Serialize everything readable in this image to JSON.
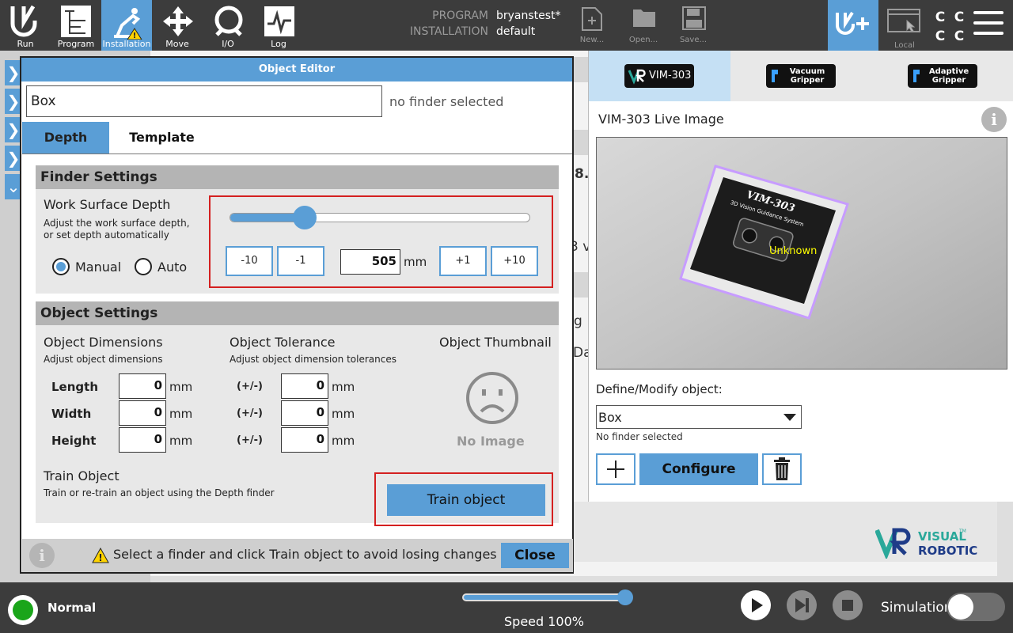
{
  "nav": [
    {
      "label": "Run",
      "icon": "ur-logo-icon"
    },
    {
      "label": "Program",
      "icon": "program-icon"
    },
    {
      "label": "Installation",
      "icon": "installation-icon"
    },
    {
      "label": "Move",
      "icon": "move-icon"
    },
    {
      "label": "I/O",
      "icon": "io-icon"
    },
    {
      "label": "Log",
      "icon": "log-icon"
    }
  ],
  "header": {
    "program_key": "PROGRAM",
    "program_value": "bryanstest*",
    "installation_key": "INSTALLATION",
    "installation_value": "default",
    "new_label": "New...",
    "open_label": "Open...",
    "save_label": "Save...",
    "local_label": "Local",
    "cc": [
      "C",
      "C",
      "C",
      "C"
    ]
  },
  "background": {
    "frag_number": "8.",
    "frag_v": "3 v",
    "frag_g": "g",
    "frag_da": "Da"
  },
  "editor": {
    "title": "Object Editor",
    "object_name": "Box",
    "finder_status": "no finder selected",
    "tabs": [
      "Depth",
      "Template"
    ],
    "finder_settings": {
      "heading": "Finder Settings",
      "work_surface_label": "Work Surface Depth",
      "work_surface_hint": "Adjust the work surface depth, or set depth automatically",
      "mode_manual": "Manual",
      "mode_auto": "Auto",
      "selected_mode": "Manual",
      "slider_fraction": 0.25,
      "steps": [
        "-10",
        "-1",
        "+1",
        "+10"
      ],
      "depth_value": "505",
      "depth_unit": "mm"
    },
    "object_settings": {
      "heading": "Object Settings",
      "dimensions_label": "Object Dimensions",
      "dimensions_hint": "Adjust object dimensions",
      "tolerance_label": "Object Tolerance",
      "tolerance_hint": "Adjust object dimension tolerances",
      "thumbnail_label": "Object Thumbnail",
      "no_image": "No Image",
      "rows": [
        {
          "name": "Length",
          "value": "0",
          "tol_label": "(+/-)",
          "tol_value": "0"
        },
        {
          "name": "Width",
          "value": "0",
          "tol_label": "(+/-)",
          "tol_value": "0"
        },
        {
          "name": "Height",
          "value": "0",
          "tol_label": "(+/-)",
          "tol_value": "0"
        }
      ],
      "unit": "mm",
      "train_label": "Train Object",
      "train_hint": "Train or re-train an object using the Depth finder",
      "train_button": "Train object"
    },
    "footer_message": "Select a finder and click Train object to avoid losing changes",
    "close_button": "Close"
  },
  "right_panel": {
    "tabs": [
      {
        "label": "VIM-303",
        "active": true
      },
      {
        "label": "Vacuum Gripper",
        "line1": "Vacuum",
        "line2": "Gripper"
      },
      {
        "label": "Adaptive Gripper",
        "line1": "Adaptive",
        "line2": "Gripper"
      }
    ],
    "vim_tag": "VR",
    "live_title": "VIM-303 Live Image",
    "overlay_label": "Unknown",
    "box_title": "VIM-303",
    "box_subtitle": "3D Vision Guidance System",
    "define_label": "Define/Modify object:",
    "selected_object": "Box",
    "no_finder": "No finder selected",
    "configure_button": "Configure",
    "logo_line1": "VISUAL",
    "logo_line2": "ROBOTICS",
    "logo_tm": "TM"
  },
  "bottom": {
    "status": "Normal",
    "speed_text": "Speed 100%",
    "speed_fraction": 1.0,
    "simulation_label": "Simulation",
    "simulation_on": false
  },
  "colors": {
    "accent": "#5a9ed6",
    "topbar": "#3c3c3c",
    "highlight_red": "#d42020",
    "status_green": "#1aa51a",
    "overlay_yellow": "#ffff00",
    "overlay_outline": "#c79cff"
  }
}
